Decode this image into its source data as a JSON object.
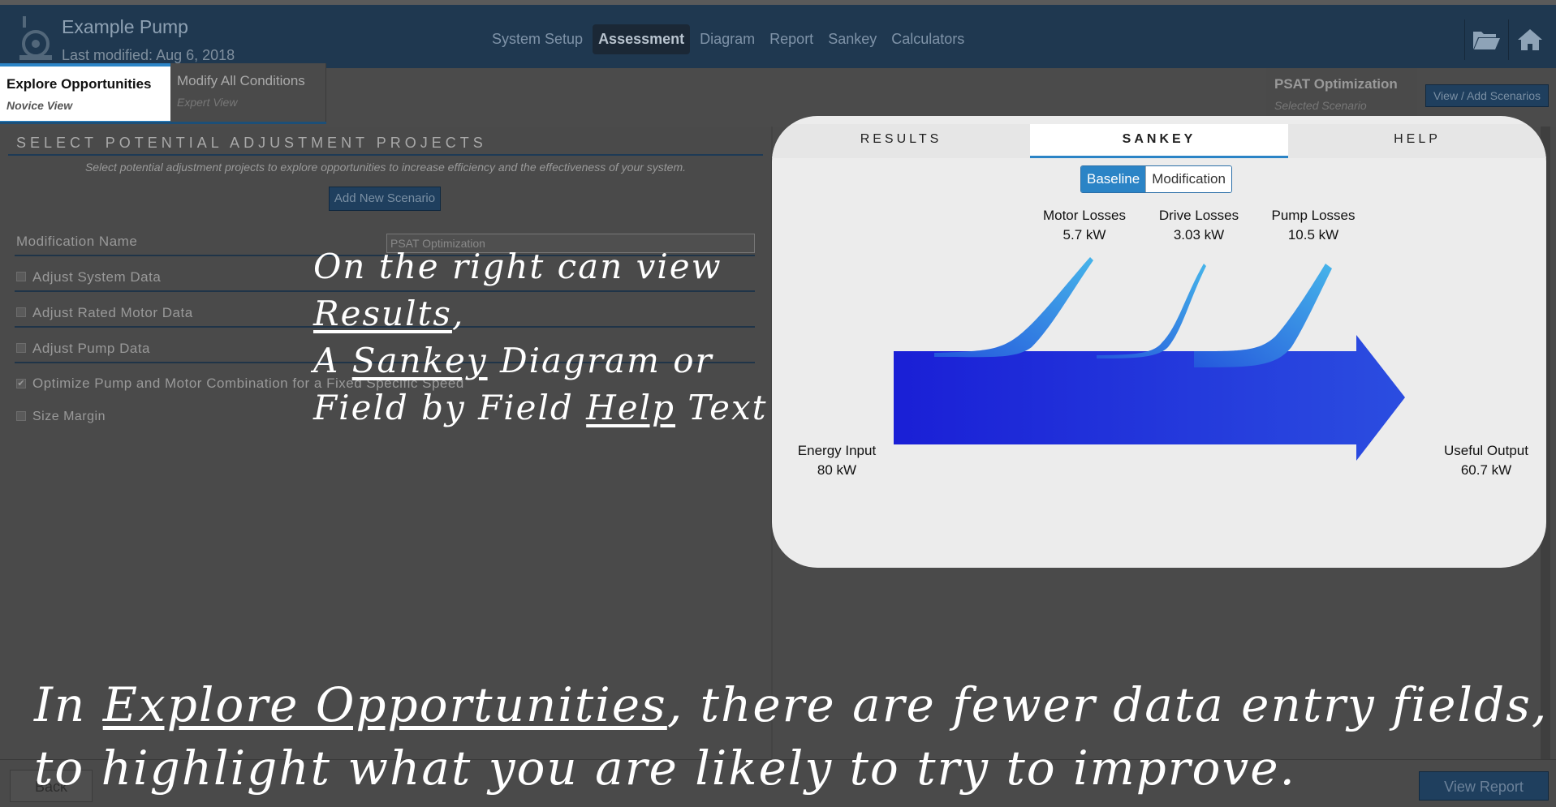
{
  "header": {
    "title": "Example Pump",
    "subtitle": "Last modified: Aug 6, 2018",
    "nav": [
      "System Setup",
      "Assessment",
      "Diagram",
      "Report",
      "Sankey",
      "Calculators"
    ],
    "active_nav": "Assessment",
    "icons": [
      "folder-open-icon",
      "home-icon"
    ]
  },
  "modes": {
    "explore": {
      "label": "Explore Opportunities",
      "sub": "Novice View"
    },
    "modify": {
      "label": "Modify All Conditions",
      "sub": "Expert View"
    }
  },
  "scenario": {
    "label": "PSAT Optimization",
    "sub": "Selected Scenario",
    "view_add_label": "View / Add Scenarios"
  },
  "left": {
    "section_title": "SELECT POTENTIAL ADJUSTMENT PROJECTS",
    "description": "Select potential adjustment projects to explore opportunities to increase efficiency and the effectiveness of your system.",
    "add_button": "Add New Scenario",
    "modification_name_label": "Modification Name",
    "modification_name_value": "PSAT Optimization",
    "options": [
      {
        "label": "Adjust System Data",
        "checked": false
      },
      {
        "label": "Adjust Rated Motor Data",
        "checked": false
      },
      {
        "label": "Adjust Pump Data",
        "checked": false
      },
      {
        "label": "Optimize Pump and Motor Combination for a Fixed Specific Speed",
        "checked": true
      },
      {
        "label": "Size Margin",
        "checked": false
      }
    ]
  },
  "right": {
    "tabs": [
      "RESULTS",
      "SANKEY",
      "HELP"
    ],
    "active_tab": "SANKEY",
    "toggle": {
      "baseline": "Baseline",
      "modification": "Modification",
      "selected": "Baseline"
    },
    "sankey": {
      "input": {
        "label": "Energy Input",
        "value": "80 kW"
      },
      "output": {
        "label": "Useful Output",
        "value": "60.7 kW"
      },
      "losses": [
        {
          "label": "Motor Losses",
          "value": "5.7 kW"
        },
        {
          "label": "Drive Losses",
          "value": "3.03 kW"
        },
        {
          "label": "Pump Losses",
          "value": "10.5 kW"
        }
      ],
      "colors": {
        "main": "#1f24d8",
        "loss": "#3aa8e0"
      }
    }
  },
  "footer": {
    "back": "Back",
    "view_report": "View Report"
  },
  "annotations": {
    "right_l1": "On the right can view",
    "right_l2": "Results",
    "right_l2_tail": ",",
    "right_l3_a": "A ",
    "right_l3_b": "Sankey",
    "right_l3_c": " Diagram or",
    "right_l4_a": "Field by Field ",
    "right_l4_b": "Help",
    "right_l4_c": " Text",
    "bottom_l1_a": "In ",
    "bottom_l1_b": "Explore Opportunities",
    "bottom_l1_c": ", there are fewer data entry fields,",
    "bottom_l2": "to highlight what you are likely to try to improve."
  }
}
